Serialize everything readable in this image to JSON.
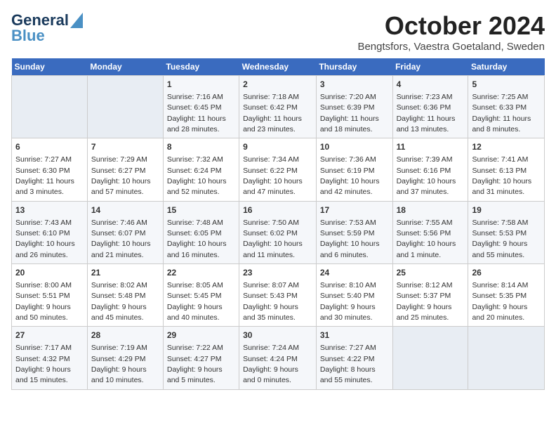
{
  "header": {
    "logo_line1": "General",
    "logo_line2": "Blue",
    "title": "October 2024",
    "subtitle": "Bengtsfors, Vaestra Goetaland, Sweden"
  },
  "days_of_week": [
    "Sunday",
    "Monday",
    "Tuesday",
    "Wednesday",
    "Thursday",
    "Friday",
    "Saturday"
  ],
  "weeks": [
    [
      {
        "day": "",
        "info": ""
      },
      {
        "day": "",
        "info": ""
      },
      {
        "day": "1",
        "info": "Sunrise: 7:16 AM\nSunset: 6:45 PM\nDaylight: 11 hours and 28 minutes."
      },
      {
        "day": "2",
        "info": "Sunrise: 7:18 AM\nSunset: 6:42 PM\nDaylight: 11 hours and 23 minutes."
      },
      {
        "day": "3",
        "info": "Sunrise: 7:20 AM\nSunset: 6:39 PM\nDaylight: 11 hours and 18 minutes."
      },
      {
        "day": "4",
        "info": "Sunrise: 7:23 AM\nSunset: 6:36 PM\nDaylight: 11 hours and 13 minutes."
      },
      {
        "day": "5",
        "info": "Sunrise: 7:25 AM\nSunset: 6:33 PM\nDaylight: 11 hours and 8 minutes."
      }
    ],
    [
      {
        "day": "6",
        "info": "Sunrise: 7:27 AM\nSunset: 6:30 PM\nDaylight: 11 hours and 3 minutes."
      },
      {
        "day": "7",
        "info": "Sunrise: 7:29 AM\nSunset: 6:27 PM\nDaylight: 10 hours and 57 minutes."
      },
      {
        "day": "8",
        "info": "Sunrise: 7:32 AM\nSunset: 6:24 PM\nDaylight: 10 hours and 52 minutes."
      },
      {
        "day": "9",
        "info": "Sunrise: 7:34 AM\nSunset: 6:22 PM\nDaylight: 10 hours and 47 minutes."
      },
      {
        "day": "10",
        "info": "Sunrise: 7:36 AM\nSunset: 6:19 PM\nDaylight: 10 hours and 42 minutes."
      },
      {
        "day": "11",
        "info": "Sunrise: 7:39 AM\nSunset: 6:16 PM\nDaylight: 10 hours and 37 minutes."
      },
      {
        "day": "12",
        "info": "Sunrise: 7:41 AM\nSunset: 6:13 PM\nDaylight: 10 hours and 31 minutes."
      }
    ],
    [
      {
        "day": "13",
        "info": "Sunrise: 7:43 AM\nSunset: 6:10 PM\nDaylight: 10 hours and 26 minutes."
      },
      {
        "day": "14",
        "info": "Sunrise: 7:46 AM\nSunset: 6:07 PM\nDaylight: 10 hours and 21 minutes."
      },
      {
        "day": "15",
        "info": "Sunrise: 7:48 AM\nSunset: 6:05 PM\nDaylight: 10 hours and 16 minutes."
      },
      {
        "day": "16",
        "info": "Sunrise: 7:50 AM\nSunset: 6:02 PM\nDaylight: 10 hours and 11 minutes."
      },
      {
        "day": "17",
        "info": "Sunrise: 7:53 AM\nSunset: 5:59 PM\nDaylight: 10 hours and 6 minutes."
      },
      {
        "day": "18",
        "info": "Sunrise: 7:55 AM\nSunset: 5:56 PM\nDaylight: 10 hours and 1 minute."
      },
      {
        "day": "19",
        "info": "Sunrise: 7:58 AM\nSunset: 5:53 PM\nDaylight: 9 hours and 55 minutes."
      }
    ],
    [
      {
        "day": "20",
        "info": "Sunrise: 8:00 AM\nSunset: 5:51 PM\nDaylight: 9 hours and 50 minutes."
      },
      {
        "day": "21",
        "info": "Sunrise: 8:02 AM\nSunset: 5:48 PM\nDaylight: 9 hours and 45 minutes."
      },
      {
        "day": "22",
        "info": "Sunrise: 8:05 AM\nSunset: 5:45 PM\nDaylight: 9 hours and 40 minutes."
      },
      {
        "day": "23",
        "info": "Sunrise: 8:07 AM\nSunset: 5:43 PM\nDaylight: 9 hours and 35 minutes."
      },
      {
        "day": "24",
        "info": "Sunrise: 8:10 AM\nSunset: 5:40 PM\nDaylight: 9 hours and 30 minutes."
      },
      {
        "day": "25",
        "info": "Sunrise: 8:12 AM\nSunset: 5:37 PM\nDaylight: 9 hours and 25 minutes."
      },
      {
        "day": "26",
        "info": "Sunrise: 8:14 AM\nSunset: 5:35 PM\nDaylight: 9 hours and 20 minutes."
      }
    ],
    [
      {
        "day": "27",
        "info": "Sunrise: 7:17 AM\nSunset: 4:32 PM\nDaylight: 9 hours and 15 minutes."
      },
      {
        "day": "28",
        "info": "Sunrise: 7:19 AM\nSunset: 4:29 PM\nDaylight: 9 hours and 10 minutes."
      },
      {
        "day": "29",
        "info": "Sunrise: 7:22 AM\nSunset: 4:27 PM\nDaylight: 9 hours and 5 minutes."
      },
      {
        "day": "30",
        "info": "Sunrise: 7:24 AM\nSunset: 4:24 PM\nDaylight: 9 hours and 0 minutes."
      },
      {
        "day": "31",
        "info": "Sunrise: 7:27 AM\nSunset: 4:22 PM\nDaylight: 8 hours and 55 minutes."
      },
      {
        "day": "",
        "info": ""
      },
      {
        "day": "",
        "info": ""
      }
    ]
  ]
}
